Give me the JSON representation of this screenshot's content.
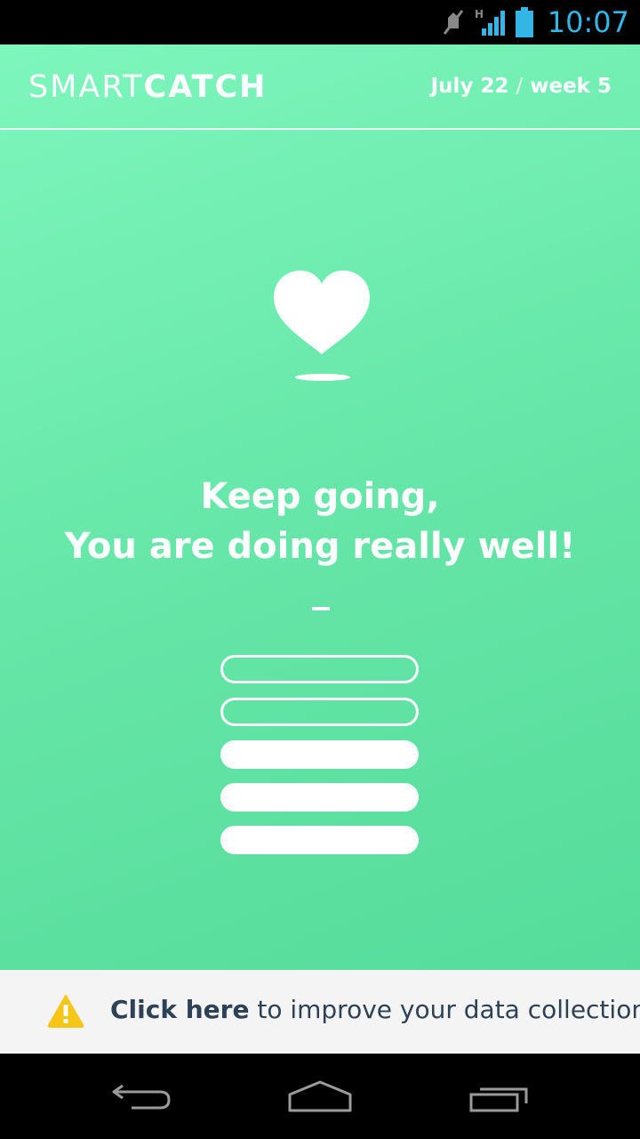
{
  "status_bar": {
    "time": "10:07",
    "icons": [
      "mute-icon",
      "signal-h-icon",
      "battery-icon"
    ],
    "clock_color": "#33b5e5"
  },
  "header": {
    "logo_light": "SMART",
    "logo_bold": "CATCH",
    "date": "July 22",
    "separator": "/",
    "week": "week 5"
  },
  "main": {
    "icon": "heart-icon",
    "message_line1": "Keep going,",
    "message_line2": "You are doing really well!",
    "progress": {
      "total": 5,
      "filled": 3
    }
  },
  "banner": {
    "icon": "warning-icon",
    "link_text": "Click here",
    "rest_text": " to improve your data collection"
  },
  "nav": {
    "buttons": [
      "back-icon",
      "home-icon",
      "recents-icon"
    ]
  },
  "colors": {
    "bg_top": "#7ef6bd",
    "bg_bottom": "#55dc9b",
    "banner_bg": "#f4f4f4",
    "banner_text": "#2d4256",
    "warning": "#f5c518"
  }
}
